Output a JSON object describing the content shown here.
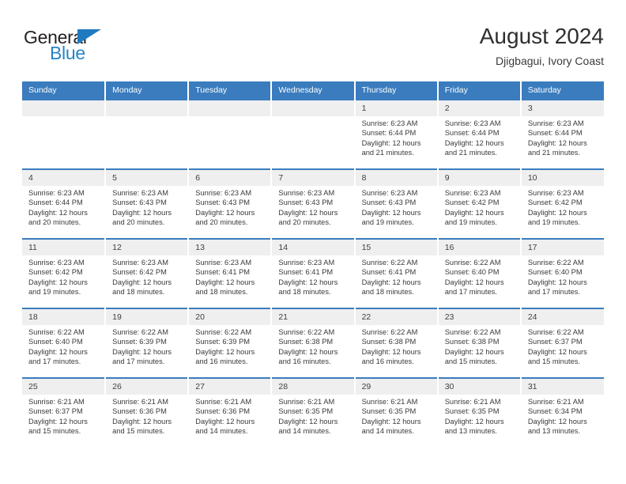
{
  "logo": {
    "word_top": "General",
    "word_bottom": "Blue",
    "triangle_icon": "blue-triangle-icon",
    "accent_dark": "#231f20",
    "accent_blue": "#2585c7"
  },
  "header": {
    "title": "August 2024",
    "subtitle": "Djigbagui, Ivory Coast"
  },
  "theme": {
    "header_blue": "#3a7cbe",
    "day_cell_gray": "#efefef",
    "text": "#3a3a3a"
  },
  "weekday_headers": [
    "Sunday",
    "Monday",
    "Tuesday",
    "Wednesday",
    "Thursday",
    "Friday",
    "Saturday"
  ],
  "weeks": [
    [
      {
        "day": "",
        "empty": true
      },
      {
        "day": "",
        "empty": true
      },
      {
        "day": "",
        "empty": true
      },
      {
        "day": "",
        "empty": true
      },
      {
        "day": "1",
        "sunrise": "Sunrise: 6:23 AM",
        "sunset": "Sunset: 6:44 PM",
        "daylight_line1": "Daylight: 12 hours",
        "daylight_line2": "and 21 minutes."
      },
      {
        "day": "2",
        "sunrise": "Sunrise: 6:23 AM",
        "sunset": "Sunset: 6:44 PM",
        "daylight_line1": "Daylight: 12 hours",
        "daylight_line2": "and 21 minutes."
      },
      {
        "day": "3",
        "sunrise": "Sunrise: 6:23 AM",
        "sunset": "Sunset: 6:44 PM",
        "daylight_line1": "Daylight: 12 hours",
        "daylight_line2": "and 21 minutes."
      }
    ],
    [
      {
        "day": "4",
        "sunrise": "Sunrise: 6:23 AM",
        "sunset": "Sunset: 6:44 PM",
        "daylight_line1": "Daylight: 12 hours",
        "daylight_line2": "and 20 minutes."
      },
      {
        "day": "5",
        "sunrise": "Sunrise: 6:23 AM",
        "sunset": "Sunset: 6:43 PM",
        "daylight_line1": "Daylight: 12 hours",
        "daylight_line2": "and 20 minutes."
      },
      {
        "day": "6",
        "sunrise": "Sunrise: 6:23 AM",
        "sunset": "Sunset: 6:43 PM",
        "daylight_line1": "Daylight: 12 hours",
        "daylight_line2": "and 20 minutes."
      },
      {
        "day": "7",
        "sunrise": "Sunrise: 6:23 AM",
        "sunset": "Sunset: 6:43 PM",
        "daylight_line1": "Daylight: 12 hours",
        "daylight_line2": "and 20 minutes."
      },
      {
        "day": "8",
        "sunrise": "Sunrise: 6:23 AM",
        "sunset": "Sunset: 6:43 PM",
        "daylight_line1": "Daylight: 12 hours",
        "daylight_line2": "and 19 minutes."
      },
      {
        "day": "9",
        "sunrise": "Sunrise: 6:23 AM",
        "sunset": "Sunset: 6:42 PM",
        "daylight_line1": "Daylight: 12 hours",
        "daylight_line2": "and 19 minutes."
      },
      {
        "day": "10",
        "sunrise": "Sunrise: 6:23 AM",
        "sunset": "Sunset: 6:42 PM",
        "daylight_line1": "Daylight: 12 hours",
        "daylight_line2": "and 19 minutes."
      }
    ],
    [
      {
        "day": "11",
        "sunrise": "Sunrise: 6:23 AM",
        "sunset": "Sunset: 6:42 PM",
        "daylight_line1": "Daylight: 12 hours",
        "daylight_line2": "and 19 minutes."
      },
      {
        "day": "12",
        "sunrise": "Sunrise: 6:23 AM",
        "sunset": "Sunset: 6:42 PM",
        "daylight_line1": "Daylight: 12 hours",
        "daylight_line2": "and 18 minutes."
      },
      {
        "day": "13",
        "sunrise": "Sunrise: 6:23 AM",
        "sunset": "Sunset: 6:41 PM",
        "daylight_line1": "Daylight: 12 hours",
        "daylight_line2": "and 18 minutes."
      },
      {
        "day": "14",
        "sunrise": "Sunrise: 6:23 AM",
        "sunset": "Sunset: 6:41 PM",
        "daylight_line1": "Daylight: 12 hours",
        "daylight_line2": "and 18 minutes."
      },
      {
        "day": "15",
        "sunrise": "Sunrise: 6:22 AM",
        "sunset": "Sunset: 6:41 PM",
        "daylight_line1": "Daylight: 12 hours",
        "daylight_line2": "and 18 minutes."
      },
      {
        "day": "16",
        "sunrise": "Sunrise: 6:22 AM",
        "sunset": "Sunset: 6:40 PM",
        "daylight_line1": "Daylight: 12 hours",
        "daylight_line2": "and 17 minutes."
      },
      {
        "day": "17",
        "sunrise": "Sunrise: 6:22 AM",
        "sunset": "Sunset: 6:40 PM",
        "daylight_line1": "Daylight: 12 hours",
        "daylight_line2": "and 17 minutes."
      }
    ],
    [
      {
        "day": "18",
        "sunrise": "Sunrise: 6:22 AM",
        "sunset": "Sunset: 6:40 PM",
        "daylight_line1": "Daylight: 12 hours",
        "daylight_line2": "and 17 minutes."
      },
      {
        "day": "19",
        "sunrise": "Sunrise: 6:22 AM",
        "sunset": "Sunset: 6:39 PM",
        "daylight_line1": "Daylight: 12 hours",
        "daylight_line2": "and 17 minutes."
      },
      {
        "day": "20",
        "sunrise": "Sunrise: 6:22 AM",
        "sunset": "Sunset: 6:39 PM",
        "daylight_line1": "Daylight: 12 hours",
        "daylight_line2": "and 16 minutes."
      },
      {
        "day": "21",
        "sunrise": "Sunrise: 6:22 AM",
        "sunset": "Sunset: 6:38 PM",
        "daylight_line1": "Daylight: 12 hours",
        "daylight_line2": "and 16 minutes."
      },
      {
        "day": "22",
        "sunrise": "Sunrise: 6:22 AM",
        "sunset": "Sunset: 6:38 PM",
        "daylight_line1": "Daylight: 12 hours",
        "daylight_line2": "and 16 minutes."
      },
      {
        "day": "23",
        "sunrise": "Sunrise: 6:22 AM",
        "sunset": "Sunset: 6:38 PM",
        "daylight_line1": "Daylight: 12 hours",
        "daylight_line2": "and 15 minutes."
      },
      {
        "day": "24",
        "sunrise": "Sunrise: 6:22 AM",
        "sunset": "Sunset: 6:37 PM",
        "daylight_line1": "Daylight: 12 hours",
        "daylight_line2": "and 15 minutes."
      }
    ],
    [
      {
        "day": "25",
        "sunrise": "Sunrise: 6:21 AM",
        "sunset": "Sunset: 6:37 PM",
        "daylight_line1": "Daylight: 12 hours",
        "daylight_line2": "and 15 minutes."
      },
      {
        "day": "26",
        "sunrise": "Sunrise: 6:21 AM",
        "sunset": "Sunset: 6:36 PM",
        "daylight_line1": "Daylight: 12 hours",
        "daylight_line2": "and 15 minutes."
      },
      {
        "day": "27",
        "sunrise": "Sunrise: 6:21 AM",
        "sunset": "Sunset: 6:36 PM",
        "daylight_line1": "Daylight: 12 hours",
        "daylight_line2": "and 14 minutes."
      },
      {
        "day": "28",
        "sunrise": "Sunrise: 6:21 AM",
        "sunset": "Sunset: 6:35 PM",
        "daylight_line1": "Daylight: 12 hours",
        "daylight_line2": "and 14 minutes."
      },
      {
        "day": "29",
        "sunrise": "Sunrise: 6:21 AM",
        "sunset": "Sunset: 6:35 PM",
        "daylight_line1": "Daylight: 12 hours",
        "daylight_line2": "and 14 minutes."
      },
      {
        "day": "30",
        "sunrise": "Sunrise: 6:21 AM",
        "sunset": "Sunset: 6:35 PM",
        "daylight_line1": "Daylight: 12 hours",
        "daylight_line2": "and 13 minutes."
      },
      {
        "day": "31",
        "sunrise": "Sunrise: 6:21 AM",
        "sunset": "Sunset: 6:34 PM",
        "daylight_line1": "Daylight: 12 hours",
        "daylight_line2": "and 13 minutes."
      }
    ]
  ]
}
